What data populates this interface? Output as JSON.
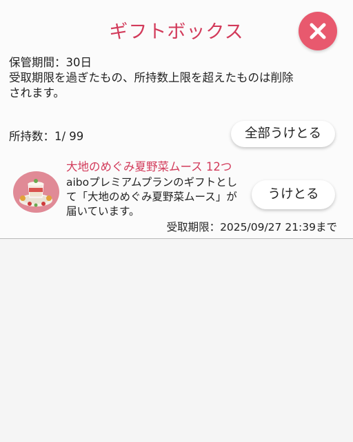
{
  "header": {
    "title": "ギフトボックス",
    "close_icon": "close-icon",
    "accent_color": "#d23a5a",
    "close_color": "#e8596e"
  },
  "info": {
    "storage_period": "保管期間：30日",
    "note_line1": "受取期限を過ぎたもの、所持数上限を超えたものは削除",
    "note_line2": "されます。"
  },
  "summary": {
    "count_text": "所持数：1/ 99",
    "receive_all_label": "全部うけとる"
  },
  "gifts": [
    {
      "name": "大地のめぐみ夏野菜ムース 12つ",
      "description": "aiboプレミアムプランのギフトとして「大地のめぐみ夏野菜ムース」が届いています。",
      "receive_label": "うけとる",
      "deadline": "受取期限：2025/09/27 21:39まで",
      "thumbnail_icon": "mousse-dish-icon"
    }
  ]
}
